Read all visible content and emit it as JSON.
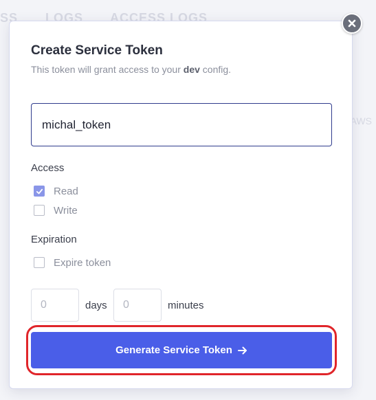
{
  "background": {
    "tabs": [
      "SS",
      "LOGS",
      "ACCESS LOGS"
    ],
    "side_right": "AWS"
  },
  "modal": {
    "title": "Create Service Token",
    "subtitle_prefix": "This token will grant access to your",
    "subtitle_config": "dev",
    "subtitle_suffix": "config.",
    "name_value": "michal_token",
    "access": {
      "label": "Access",
      "options": [
        {
          "label": "Read",
          "checked": true
        },
        {
          "label": "Write",
          "checked": false
        }
      ]
    },
    "expiration": {
      "label": "Expiration",
      "expire_label": "Expire token",
      "expire_checked": false,
      "days_placeholder": "0",
      "days_label": "days",
      "minutes_placeholder": "0",
      "minutes_label": "minutes"
    },
    "generate_button": "Generate Service Token"
  },
  "colors": {
    "primary": "#4a5ee8",
    "input_focus_border": "#2e3a8c",
    "checked": "#8a96e8",
    "highlight": "#e0252a",
    "close_button": "#6b6f7b"
  },
  "icons": {
    "close": "close-icon",
    "arrow": "arrow-right-icon",
    "check": "checkmark-icon"
  }
}
